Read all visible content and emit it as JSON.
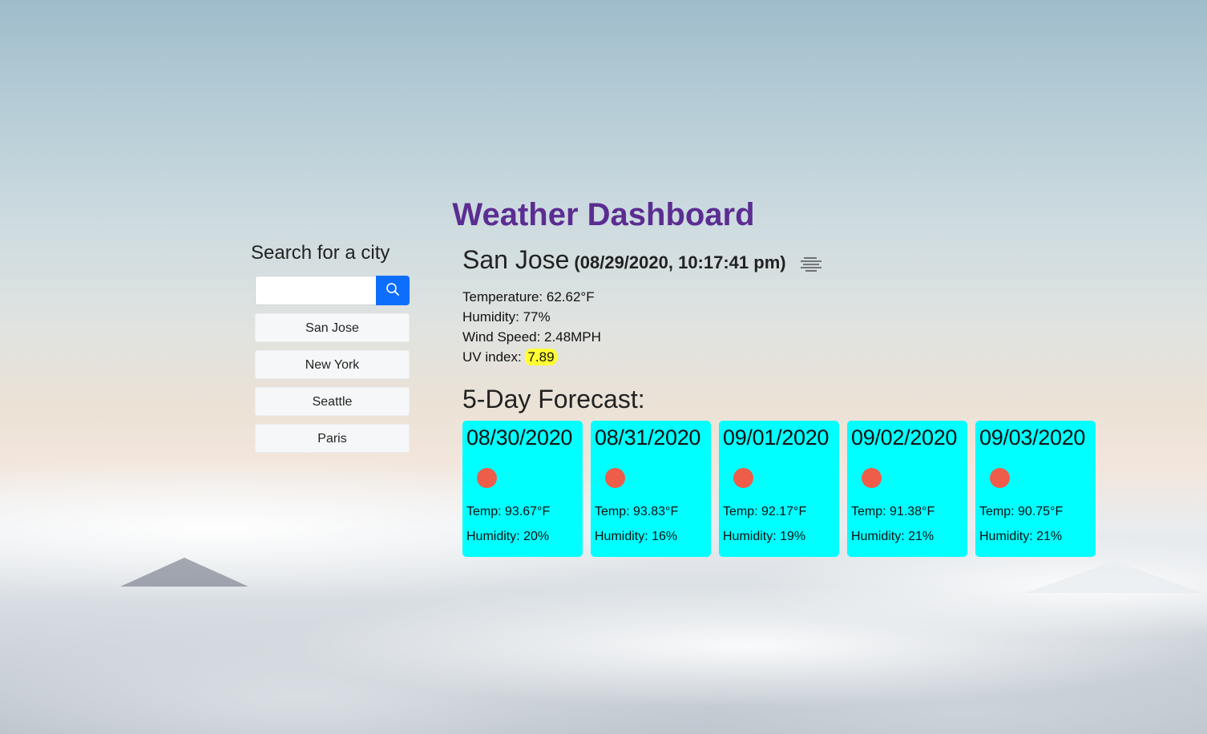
{
  "app": {
    "title": "Weather Dashboard"
  },
  "search": {
    "heading": "Search for a city",
    "input_value": "",
    "placeholder": "",
    "button_icon": "search-icon",
    "cities": [
      "San Jose",
      "New York",
      "Seattle",
      "Paris"
    ]
  },
  "current": {
    "city": "San Jose",
    "date": "(08/29/2020, 10:17:41 pm)",
    "icon": "mist-icon",
    "temperature": "Temperature: 62.62°F",
    "humidity": "Humidity: 77%",
    "wind": "Wind Speed: 2.48MPH",
    "uv_label": "UV index:",
    "uv_value": "7.89"
  },
  "forecast": {
    "heading": "5-Day Forecast:",
    "days": [
      {
        "date": "08/30/2020",
        "icon": "sun-icon",
        "temp": "Temp: 93.67°F",
        "humidity": "Humidity: 20%"
      },
      {
        "date": "08/31/2020",
        "icon": "sun-icon",
        "temp": "Temp: 93.83°F",
        "humidity": "Humidity: 16%"
      },
      {
        "date": "09/01/2020",
        "icon": "sun-icon",
        "temp": "Temp: 92.17°F",
        "humidity": "Humidity: 19%"
      },
      {
        "date": "09/02/2020",
        "icon": "sun-icon",
        "temp": "Temp: 91.38°F",
        "humidity": "Humidity: 21%"
      },
      {
        "date": "09/03/2020",
        "icon": "sun-icon",
        "temp": "Temp: 90.75°F",
        "humidity": "Humidity: 21%"
      }
    ]
  },
  "colors": {
    "title": "#5c2d91",
    "search_button": "#0d6efd",
    "card_background": "#00ffff",
    "sun_icon": "#ee5c4a",
    "uv_highlight": "#ffff33"
  }
}
